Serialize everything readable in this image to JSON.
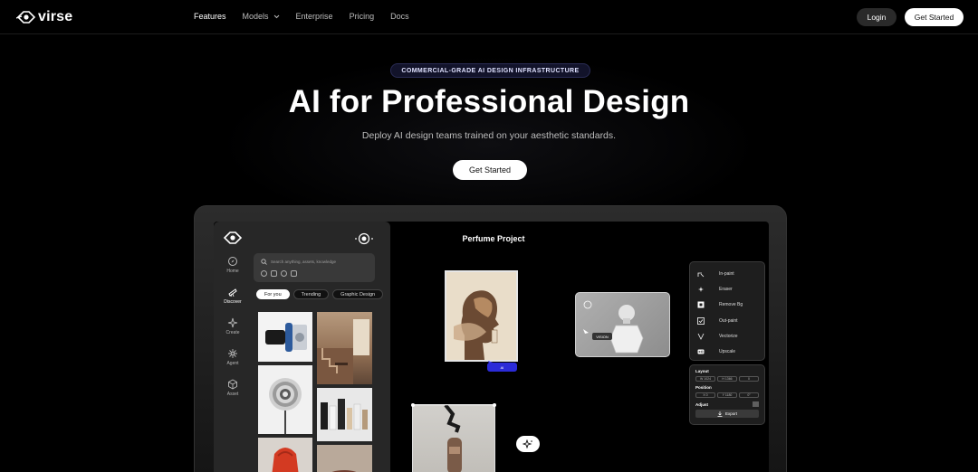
{
  "nav": {
    "brand": "virse",
    "links": [
      {
        "label": "Features",
        "active": true
      },
      {
        "label": "Models",
        "dropdown": true
      },
      {
        "label": "Enterprise"
      },
      {
        "label": "Pricing"
      },
      {
        "label": "Docs"
      }
    ],
    "login_label": "Login",
    "get_started_label": "Get Started"
  },
  "hero": {
    "badge": "COMMERCIAL-GRADE AI DESIGN INFRASTRUCTURE",
    "title": "AI for Professional Design",
    "subtitle": "Deploy AI design teams trained on your aesthetic standards.",
    "cta_label": "Get Started"
  },
  "app": {
    "side_nav": [
      "Home",
      "Discover",
      "Create",
      "Agent",
      "Asset"
    ],
    "active_side_nav": "Discover",
    "search_placeholder": "Search anything, assets, knowledge",
    "chips": [
      "For you",
      "Trending",
      "Graphic Design"
    ],
    "active_chip": "For you",
    "canvas_title": "Perfume Project",
    "cursor_tag": "AI",
    "vision_tag": "VISION",
    "tools": [
      {
        "label": "In-paint",
        "icon": "inpaint-icon"
      },
      {
        "label": "Eraser",
        "icon": "eraser-icon"
      },
      {
        "label": "Remove Bg",
        "icon": "remove-bg-icon"
      },
      {
        "label": "Out-paint",
        "icon": "outpaint-icon"
      },
      {
        "label": "Vectorize",
        "icon": "vectorize-icon"
      },
      {
        "label": "Upscale",
        "icon": "upscale-icon"
      }
    ],
    "props": {
      "layout_label": "Layout",
      "layout_fields": [
        "W 1024",
        "H 1366",
        "0"
      ],
      "position_label": "Position",
      "position_fields": [
        "X 0",
        "Y 1180",
        "0°"
      ],
      "adjust_label": "Adjust",
      "export_label": "Export"
    }
  },
  "colors": {
    "background": "#000000",
    "badge_bg": "#12132a",
    "accent_blue": "#2b2bd8"
  }
}
